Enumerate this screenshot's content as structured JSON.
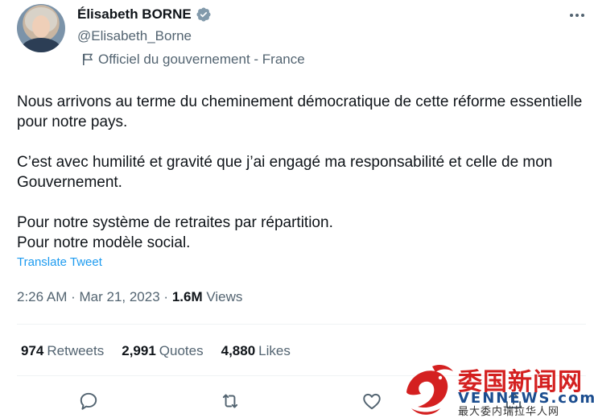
{
  "author": {
    "name": "Élisabeth BORNE",
    "handle": "@Elisabeth_Borne",
    "affiliation": "Officiel du gouvernement - France"
  },
  "tweet": {
    "paragraphs": [
      "Nous arrivons au terme du cheminement démocratique de cette réforme essentielle pour notre pays.",
      "C’est avec humilité et gravité que j’ai engagé ma responsabilité et celle de mon Gouvernement.",
      "Pour notre système de retraites par répartition.\nPour notre modèle social."
    ],
    "translate_label": "Translate Tweet"
  },
  "meta": {
    "time": "2:26 AM",
    "date": "Mar 21, 2023",
    "views_count": "1.6M",
    "views_label": "Views"
  },
  "stats": {
    "retweets_count": "974",
    "retweets_label": "Retweets",
    "quotes_count": "2,991",
    "quotes_label": "Quotes",
    "likes_count": "4,880",
    "likes_label": "Likes"
  },
  "watermark": {
    "title": "委国新闻网",
    "subtitle": "VENNEWS.com",
    "caption": "最大委内瑞拉华人网"
  },
  "colors": {
    "accent": "#1d9bf0",
    "text": "#0f1419",
    "secondary": "#536471",
    "divider": "#eff3f4",
    "verified": "#829aab"
  }
}
